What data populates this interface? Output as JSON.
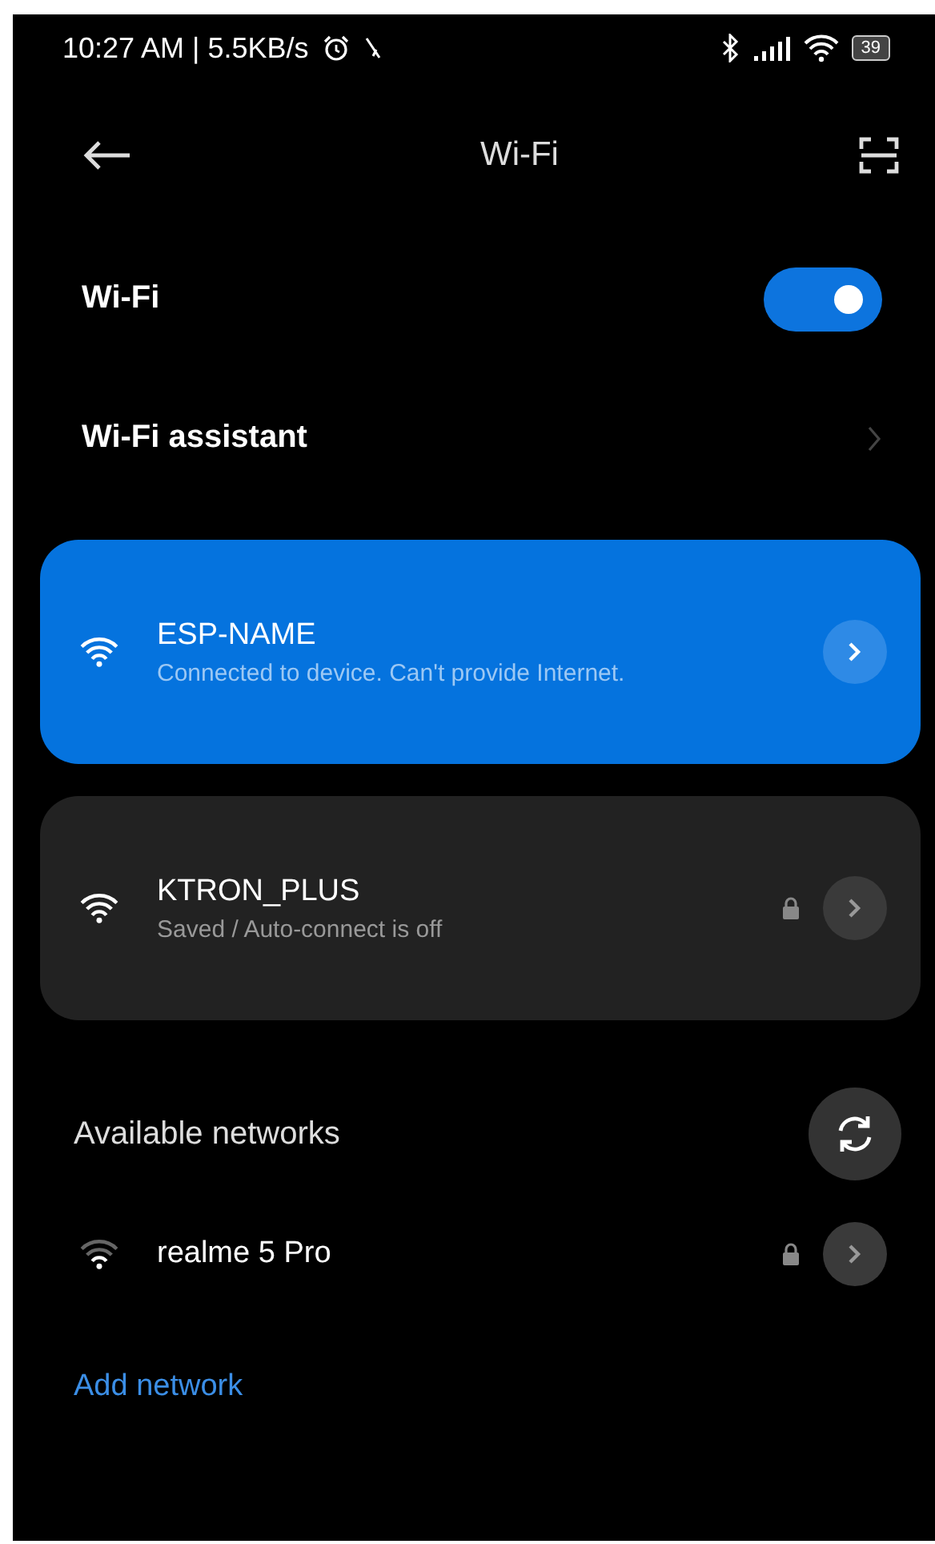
{
  "status_bar": {
    "time": "10:27 AM | 5.5KB/s",
    "battery": "39"
  },
  "header": {
    "title": "Wi-Fi"
  },
  "settings": [
    {
      "kind": "toggle",
      "label": "Wi-Fi",
      "on": true
    },
    {
      "kind": "link",
      "label": "Wi-Fi assistant"
    }
  ],
  "saved_networks": [
    {
      "name": "ESP-NAME",
      "status": "Connected to device. Can't provide Internet.",
      "connected": true,
      "secured": false
    },
    {
      "name": "KTRON_PLUS",
      "status": "Saved / Auto-connect is off",
      "connected": false,
      "secured": true
    }
  ],
  "available": {
    "title": "Available networks",
    "networks": [
      {
        "name": "realme 5 Pro",
        "secured": true
      }
    ]
  },
  "add_network": "Add network"
}
